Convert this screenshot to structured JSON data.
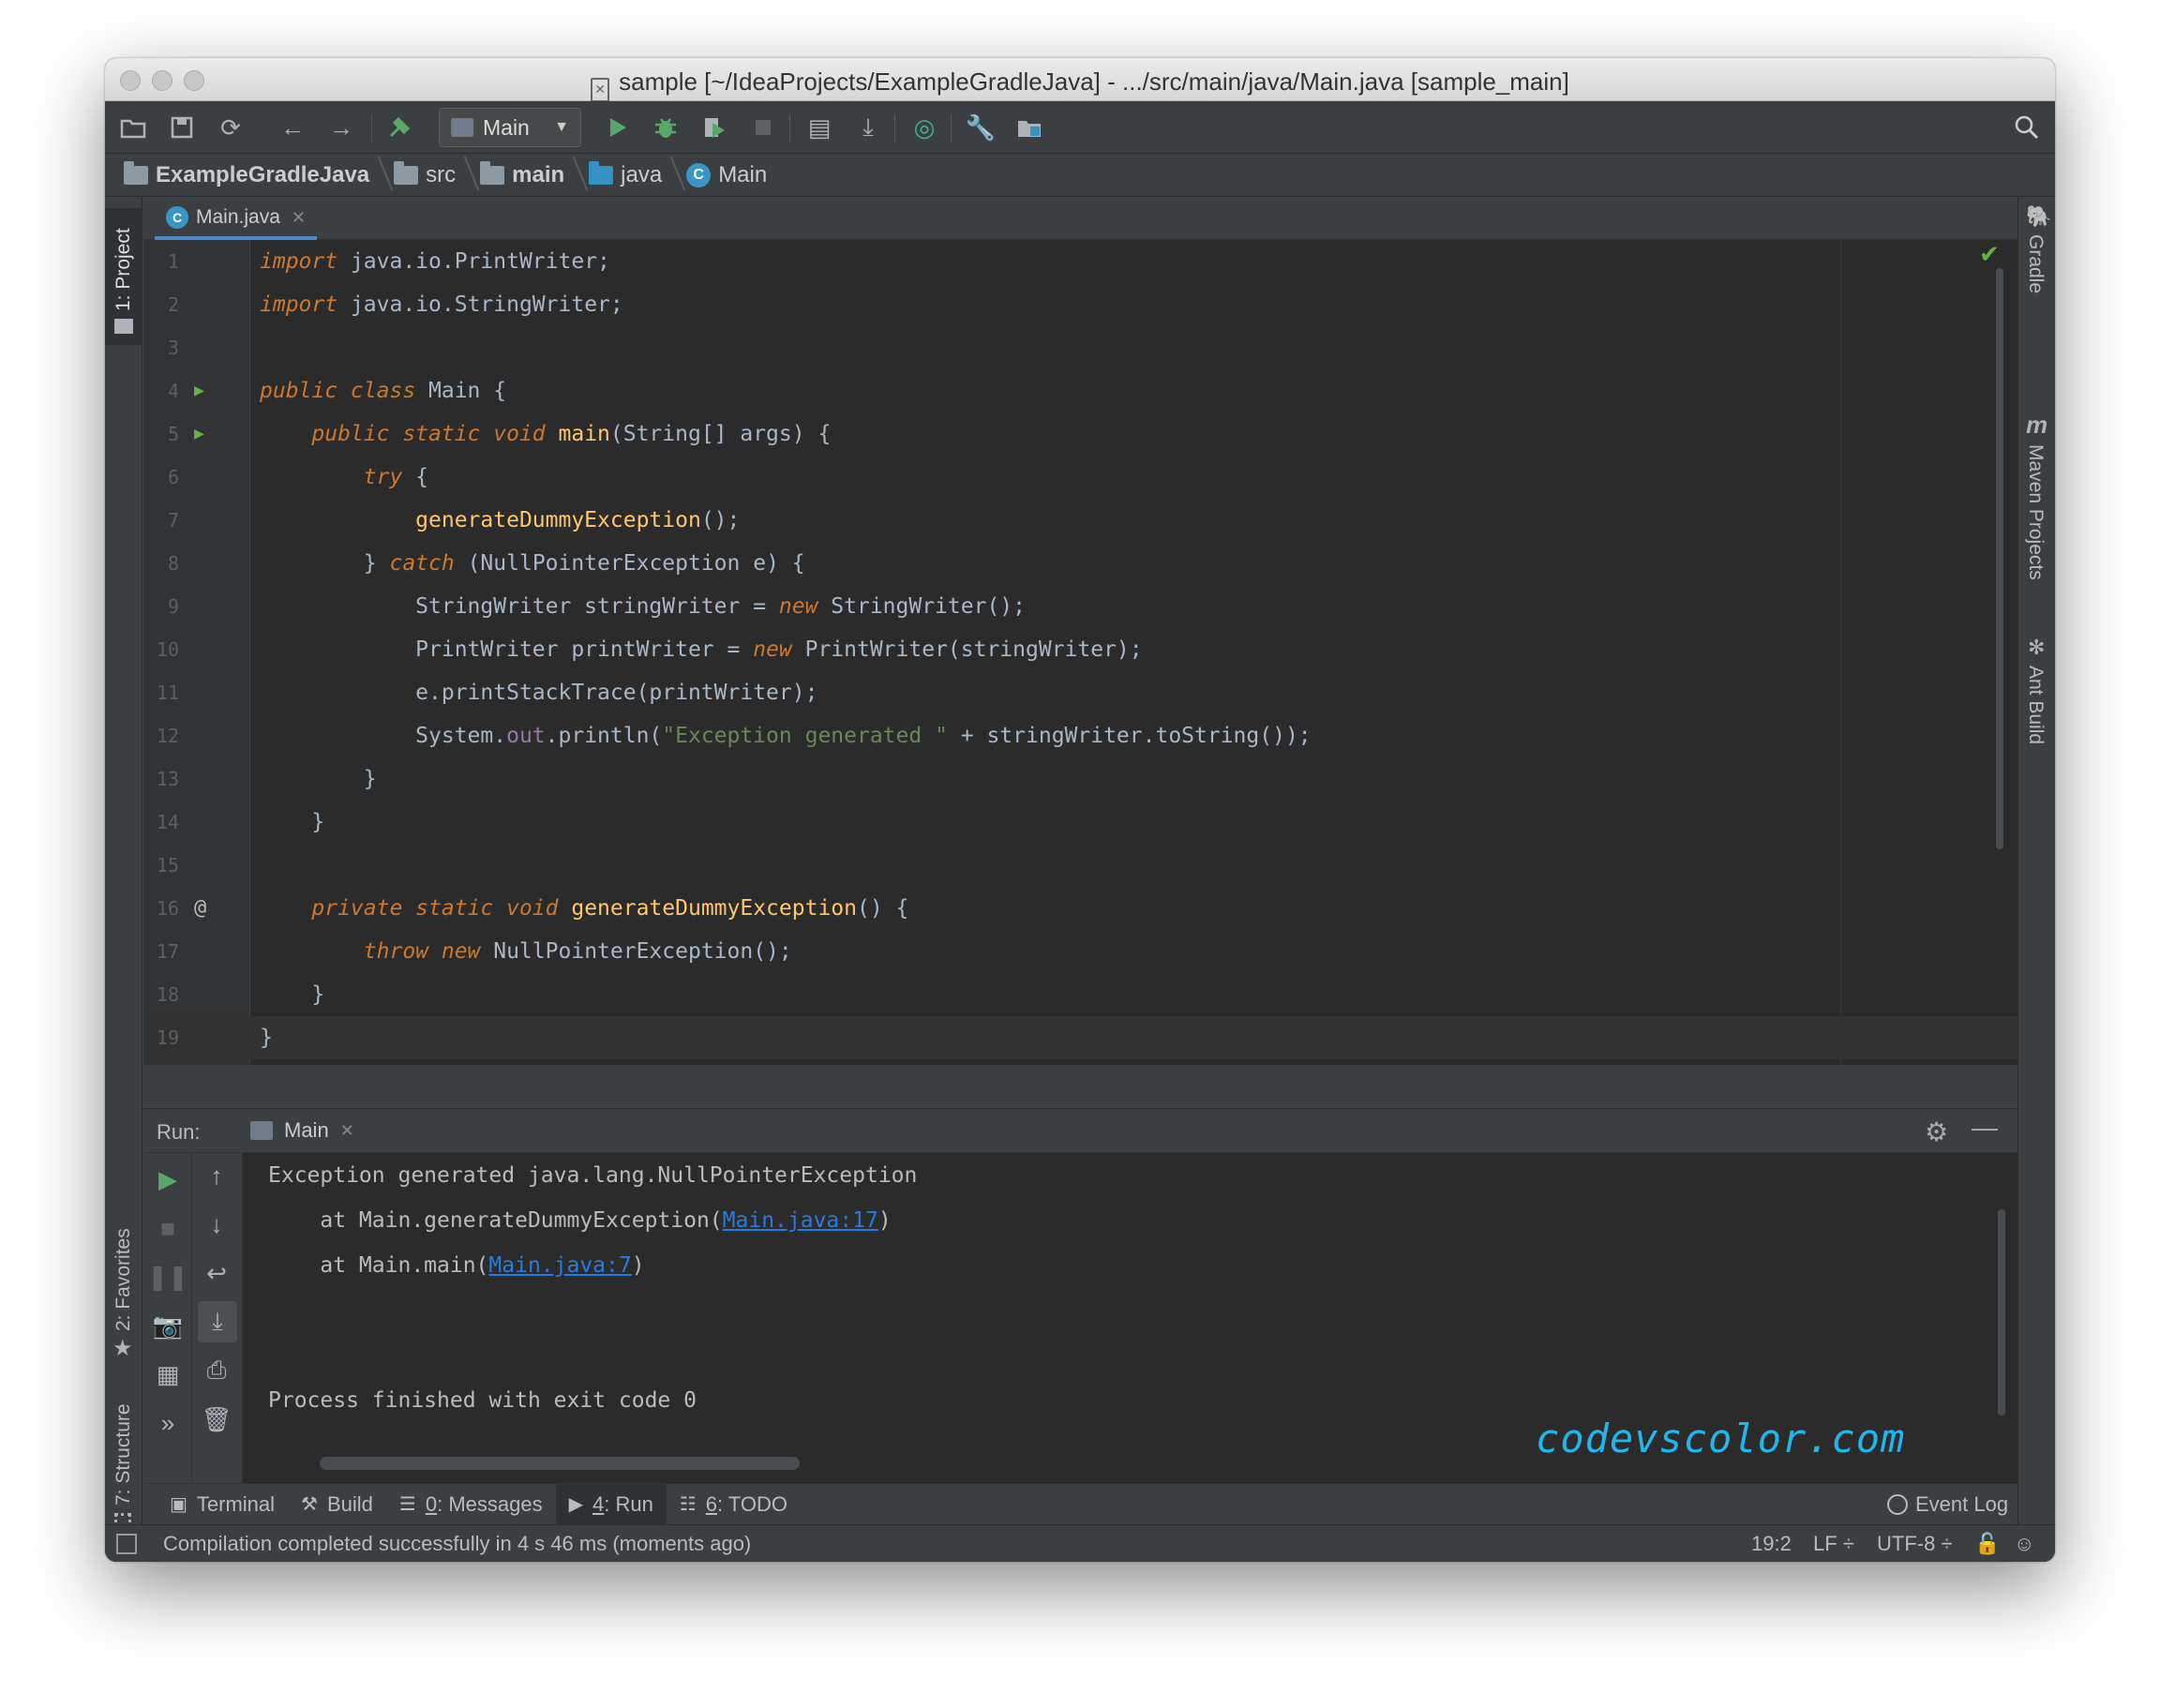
{
  "window": {
    "title": "sample [~/IdeaProjects/ExampleGradleJava] - .../src/main/java/Main.java [sample_main]"
  },
  "toolbar": {
    "run_config": "Main"
  },
  "breadcrumbs": [
    "ExampleGradleJava",
    "src",
    "main",
    "java",
    "Main"
  ],
  "left_strip": {
    "project": "1: Project",
    "favorites": "2: Favorites",
    "structure": "7: Structure"
  },
  "right_strip": {
    "gradle": "Gradle",
    "maven": "Maven Projects",
    "ant": "Ant Build"
  },
  "editor": {
    "tab": "Main.java",
    "line_numbers": [
      "1",
      "2",
      "3",
      "4",
      "5",
      "6",
      "7",
      "8",
      "9",
      "10",
      "11",
      "12",
      "13",
      "14",
      "15",
      "16",
      "17",
      "18",
      "19"
    ]
  },
  "run": {
    "label": "Run:",
    "tab": "Main",
    "console": {
      "line1": "Exception generated java.lang.NullPointerException",
      "line2_prefix": "    at Main.generateDummyException(",
      "line2_link": "Main.java:17",
      "line2_suffix": ")",
      "line3_prefix": "    at Main.main(",
      "line3_link": "Main.java:7",
      "line3_suffix": ")",
      "line4": "Process finished with exit code 0"
    }
  },
  "watermark": "codevscolor.com",
  "bottom_tabs": {
    "terminal": "Terminal",
    "build": "Build",
    "messages_num": "0",
    "messages": ": Messages",
    "run_num": "4",
    "run": ": Run",
    "todo_num": "6",
    "todo": ": TODO",
    "event_log": "Event Log"
  },
  "status": {
    "message": "Compilation completed successfully in 4 s 46 ms (moments ago)",
    "position": "19:2",
    "line_sep": "LF ÷",
    "encoding": "UTF-8 ÷"
  },
  "colors": {
    "accent": "#4a88c7",
    "keyword": "#cc7832",
    "method": "#ffc66d",
    "string": "#6a8759",
    "field": "#9876aa",
    "link": "#287bde",
    "run_green": "#59a869"
  }
}
